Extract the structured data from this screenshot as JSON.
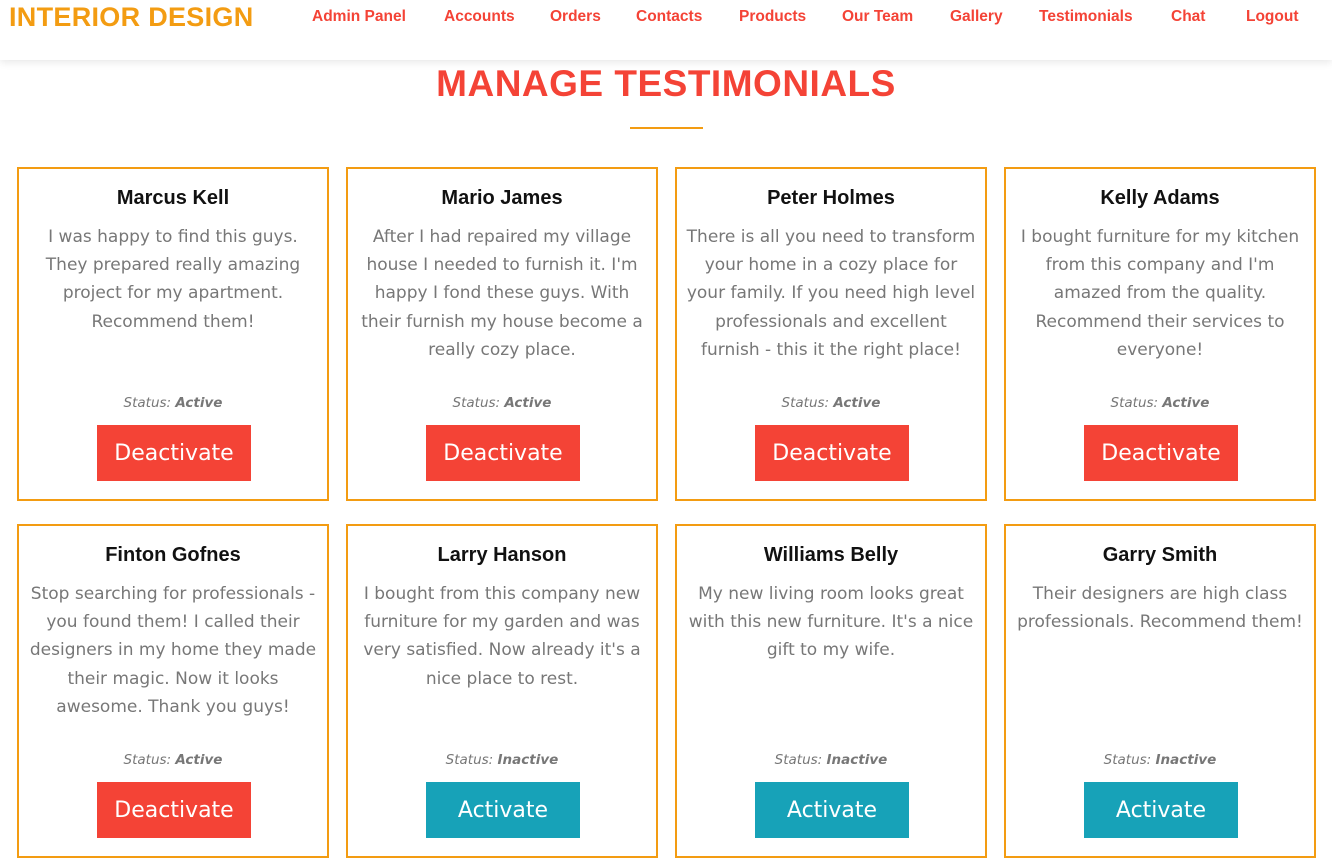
{
  "brand": "INTERIOR DESIGN",
  "nav": {
    "items": [
      "Admin Panel",
      "Accounts",
      "Orders",
      "Contacts",
      "Products",
      "Our Team",
      "Gallery",
      "Testimonials",
      "Chat",
      "Logout"
    ]
  },
  "page": {
    "title": "MANAGE TESTIMONIALS"
  },
  "status_label": "Status:",
  "colors": {
    "brand": "#f39c12",
    "accent": "#f44336",
    "activate": "#17a2b8",
    "border": "#f39c12"
  },
  "testimonials": [
    {
      "name": "Marcus Kell",
      "text": "I was happy to find this guys. They prepared really amazing project for my apartment. Recommend them!",
      "status": "Active",
      "button": "Deactivate"
    },
    {
      "name": "Mario James",
      "text": "After I had repaired my village house I needed to furnish it. I'm happy I fond these guys. With their furnish my house become a really cozy place.",
      "status": "Active",
      "button": "Deactivate"
    },
    {
      "name": "Peter Holmes",
      "text": "There is all you need to transform your home in a cozy place for your family. If you need high level professionals and excellent furnish - this it the right place!",
      "status": "Active",
      "button": "Deactivate"
    },
    {
      "name": "Kelly Adams",
      "text": "I bought furniture for my kitchen from this company and I'm amazed from the quality. Recommend their services to everyone!",
      "status": "Active",
      "button": "Deactivate"
    },
    {
      "name": "Finton Gofnes",
      "text": "Stop searching for professionals - you found them! I called their designers in my home they made their magic. Now it looks awesome. Thank you guys!",
      "status": "Active",
      "button": "Deactivate"
    },
    {
      "name": "Larry Hanson",
      "text": "I bought from this company new furniture for my garden and was very satisfied. Now already it's a nice place to rest.",
      "status": "Inactive",
      "button": "Activate"
    },
    {
      "name": "Williams Belly",
      "text": "My new living room looks great with this new furniture. It's a nice gift to my wife.",
      "status": "Inactive",
      "button": "Activate"
    },
    {
      "name": "Garry Smith",
      "text": "Their designers are high class professionals. Recommend them!",
      "status": "Inactive",
      "button": "Activate"
    }
  ]
}
